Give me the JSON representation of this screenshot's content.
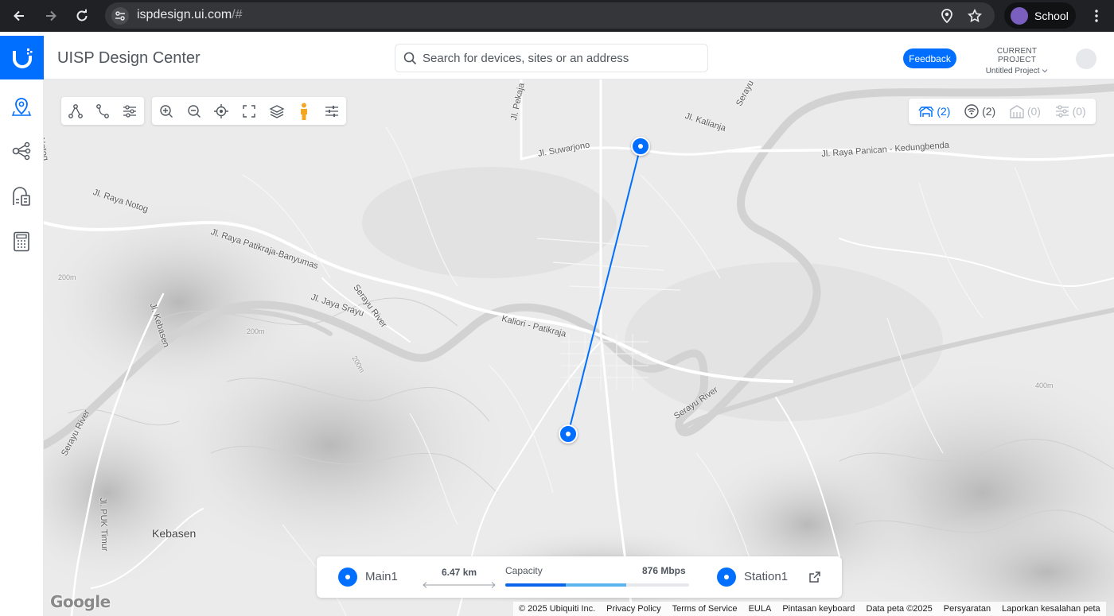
{
  "browser": {
    "url_host": "ispdesign.ui.com",
    "url_path": "/#",
    "profile_name": "School"
  },
  "header": {
    "title": "UISP Design Center",
    "search_placeholder": "Search for devices, sites or an address",
    "feedback_label": "Feedback",
    "project_label": "CURRENT PROJECT",
    "project_name": "Untitled Project"
  },
  "map": {
    "labels": {
      "pekaja": "Jl. Pekaja",
      "notog": "Notog",
      "raya_notog": "Jl. Raya Notog",
      "suwarjono": "Jl. Suwarjono",
      "kalianja": "Jl. Kalianja",
      "raya_panican": "Jl. Raya Panican - Kedungbenda",
      "serayu_river_top": "Serayu River",
      "raya_patikraja": "Jl. Raya Patikraja-Banyumas",
      "jaya_srayu": "Jl. Jaya Srayu",
      "kaliori": "Kaliori - Patikraja",
      "serayu_river_mid": "Serayu River",
      "serayu_river_left": "Serayu River",
      "kebasen_road": "Jl. Kebasen",
      "puk_timur": "Jl. PUK Timur",
      "kebasen": "Kebasen",
      "c200_a": "200m",
      "c200_b": "200m",
      "c200_c": "200m",
      "c400": "400m"
    },
    "counts": {
      "sites": "(2)",
      "wireless": "(2)",
      "buildings": "(0)",
      "filters": "(0)"
    },
    "colors": {
      "link": "#006fff",
      "active_count": "#006fff",
      "inactive_count": "#b8bcc3"
    }
  },
  "link_panel": {
    "site_a": "Main1",
    "site_b": "Station1",
    "distance": "6.47 km",
    "capacity_label": "Capacity",
    "capacity_value": "876 Mbps",
    "capacity_fill_primary": 0.33,
    "capacity_fill_secondary": 0.33
  },
  "footer": {
    "google": "Google",
    "copyright": "© 2025 Ubiquiti Inc.",
    "privacy": "Privacy Policy",
    "terms": "Terms of Service",
    "eula": "EULA",
    "shortcuts": "Pintasan keyboard",
    "map_data": "Data peta ©2025",
    "conditions": "Persyaratan",
    "report": "Laporkan kesalahan peta"
  }
}
